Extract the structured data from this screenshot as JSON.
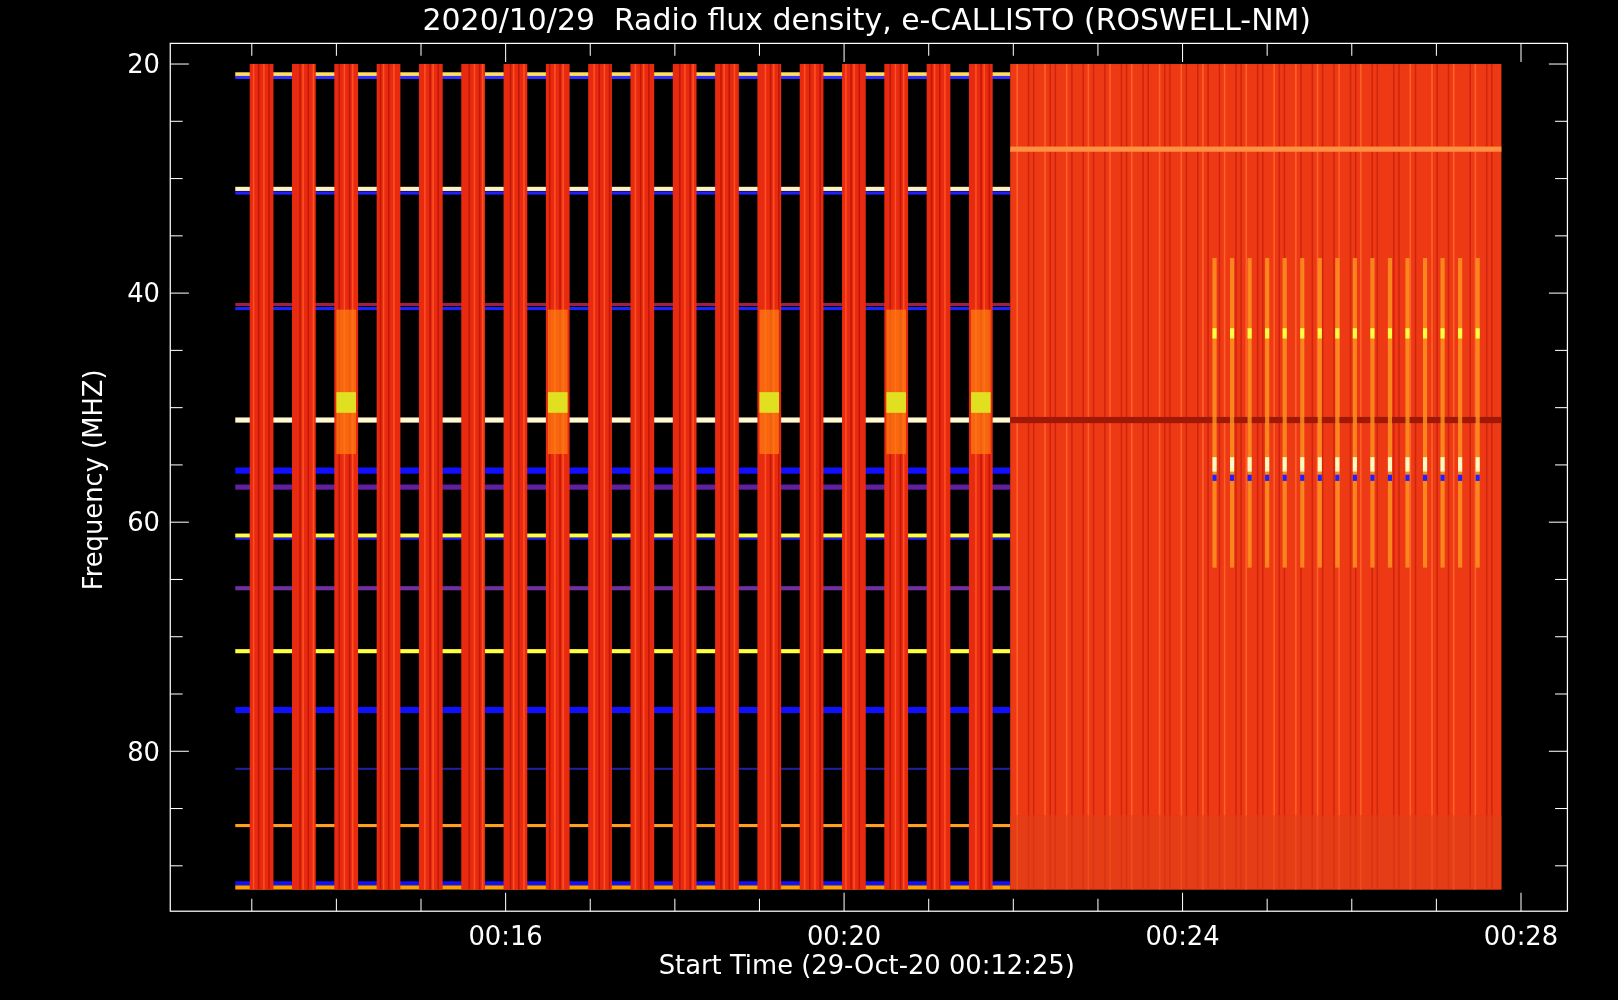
{
  "title": "2020/10/29  Radio flux density, e-CALLISTO (ROSWELL-NM)",
  "y_axis": {
    "label": "Frequency (MHZ)",
    "ticks": [
      "20",
      "40",
      "60",
      "80"
    ]
  },
  "x_axis": {
    "label": "Start Time (29-Oct-20 00:12:25)",
    "ticks": [
      "00:16",
      "00:20",
      "00:24",
      "00:28"
    ]
  }
}
